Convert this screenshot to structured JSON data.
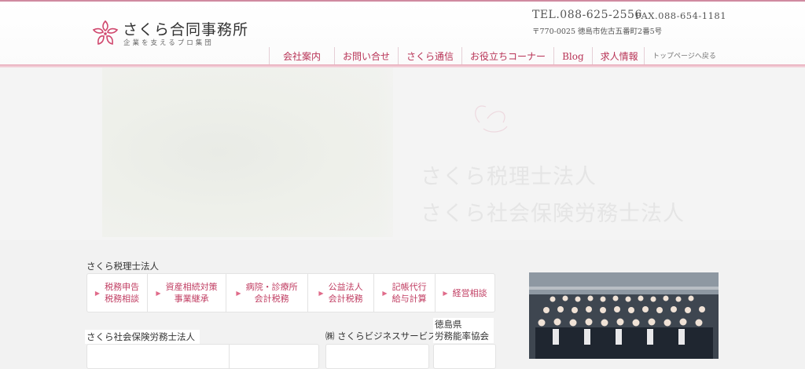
{
  "header": {
    "logo_title": "さくら合同事務所",
    "logo_subtitle": "企業を支えるプロ集団",
    "tel": "TEL.088-625-2556",
    "fax": "FAX.088-654-1181",
    "address": "〒770-0025 徳島市佐古五番町2番5号"
  },
  "nav": {
    "items": [
      {
        "label": "会社案内"
      },
      {
        "label": "お問い合せ"
      },
      {
        "label": "さくら通信"
      },
      {
        "label": "お役立ちコーナー"
      },
      {
        "label": "Blog"
      },
      {
        "label": "求人情報"
      }
    ],
    "top_link": "トップページへ戻る"
  },
  "hero": {
    "line1": "さくら税理士法人",
    "line2": "さくら社会保険労務士法人"
  },
  "tax_section": {
    "title": "さくら税理士法人",
    "services": [
      {
        "line1": "税務申告",
        "line2": "税務相談"
      },
      {
        "line1": "資産相続対策",
        "line2": "事業継承"
      },
      {
        "line1": "病院・診療所",
        "line2": "会計税務"
      },
      {
        "line1": "公益法人",
        "line2": "会計税務"
      },
      {
        "line1": "記帳代行",
        "line2": "給与計算"
      },
      {
        "line1": "経営相談",
        "line2": ""
      }
    ]
  },
  "sr_section": {
    "title": "さくら社会保険労務士法人"
  },
  "biz_section": {
    "title": "㈱ さくらビジネスサービス"
  },
  "assoc_section": {
    "title_line1": "徳島県",
    "title_line2": "労務能率協会"
  },
  "colors": {
    "accent": "#c03d62",
    "nav_text": "#b83356",
    "header_rule": "#e8a9b9"
  }
}
